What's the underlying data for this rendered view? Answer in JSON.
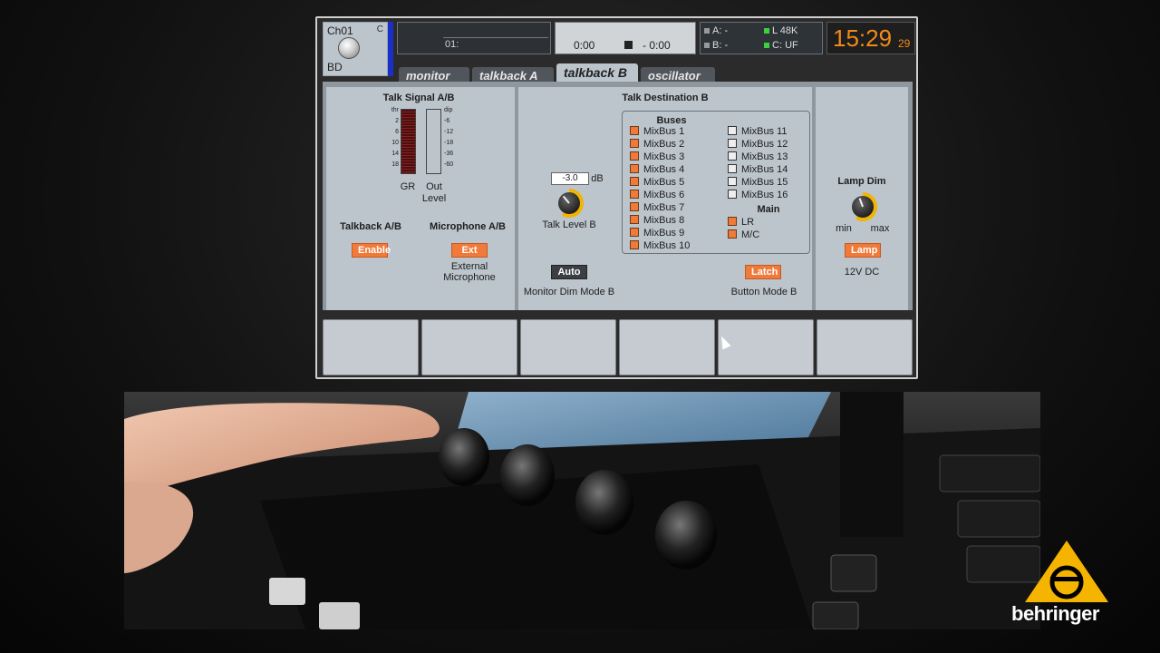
{
  "topbar": {
    "channel": "Ch01",
    "channel_flag": "C",
    "channel_label": "BD",
    "scene_number": "01:",
    "tape_time": "0:00",
    "tape_remaining": "- 0:00",
    "status": {
      "a_label": "A:",
      "a_value": "-",
      "b_label": "B:",
      "b_value": "-",
      "l_label": "L",
      "l_value": "48K",
      "c_label": "C:",
      "c_value": "UF"
    },
    "clock": "15:29",
    "clock_seconds": "29"
  },
  "tabs": [
    {
      "label": "monitor"
    },
    {
      "label": "talkback A"
    },
    {
      "label": "talkback B"
    },
    {
      "label": "oscillator"
    }
  ],
  "talk_signal": {
    "title": "Talk Signal A/B",
    "left_scale": [
      "thr",
      "2",
      "6",
      "10",
      "14",
      "18"
    ],
    "right_scale": [
      "dip",
      "-6",
      "-12",
      "-18",
      "-36",
      "-60"
    ],
    "gr_label": "GR",
    "out_label": "Out",
    "level_label": "Level",
    "talkback_title": "Talkback A/B",
    "enable_button": "Enable",
    "mic_title": "Microphone A/B",
    "ext_button": "Ext",
    "external_label": "External",
    "microphone_label": "Microphone"
  },
  "talk_dest": {
    "title": "Talk Destination B",
    "level_value": "-3.0",
    "level_unit": "dB",
    "level_label": "Talk Level B",
    "buses_title": "Buses",
    "buses_left": [
      {
        "label": "MixBus 1",
        "on": true
      },
      {
        "label": "MixBus 2",
        "on": true
      },
      {
        "label": "MixBus 3",
        "on": true
      },
      {
        "label": "MixBus 4",
        "on": true
      },
      {
        "label": "MixBus 5",
        "on": true
      },
      {
        "label": "MixBus 6",
        "on": true
      },
      {
        "label": "MixBus 7",
        "on": true
      },
      {
        "label": "MixBus 8",
        "on": true
      },
      {
        "label": "MixBus 9",
        "on": true
      },
      {
        "label": "MixBus 10",
        "on": true
      }
    ],
    "buses_right": [
      {
        "label": "MixBus 11",
        "on": false
      },
      {
        "label": "MixBus 12",
        "on": false
      },
      {
        "label": "MixBus 13",
        "on": false
      },
      {
        "label": "MixBus 14",
        "on": false
      },
      {
        "label": "MixBus 15",
        "on": false
      },
      {
        "label": "MixBus 16",
        "on": false
      }
    ],
    "main_title": "Main",
    "main": [
      {
        "label": "LR",
        "on": true
      },
      {
        "label": "M/C",
        "on": true
      }
    ],
    "auto_button": "Auto",
    "dim_mode_label": "Monitor Dim Mode B",
    "latch_button": "Latch",
    "button_mode_label": "Button Mode B"
  },
  "lamp": {
    "title": "Lamp Dim",
    "min_label": "min",
    "max_label": "max",
    "lamp_button": "Lamp",
    "voltage_label": "12V DC"
  },
  "logo": {
    "text": "behringer"
  },
  "colors": {
    "accent_orange": "#ef7a3a",
    "clock_orange": "#f08a18",
    "knob_yellow": "#f2b400",
    "channel_blue": "#1a2ec9"
  }
}
